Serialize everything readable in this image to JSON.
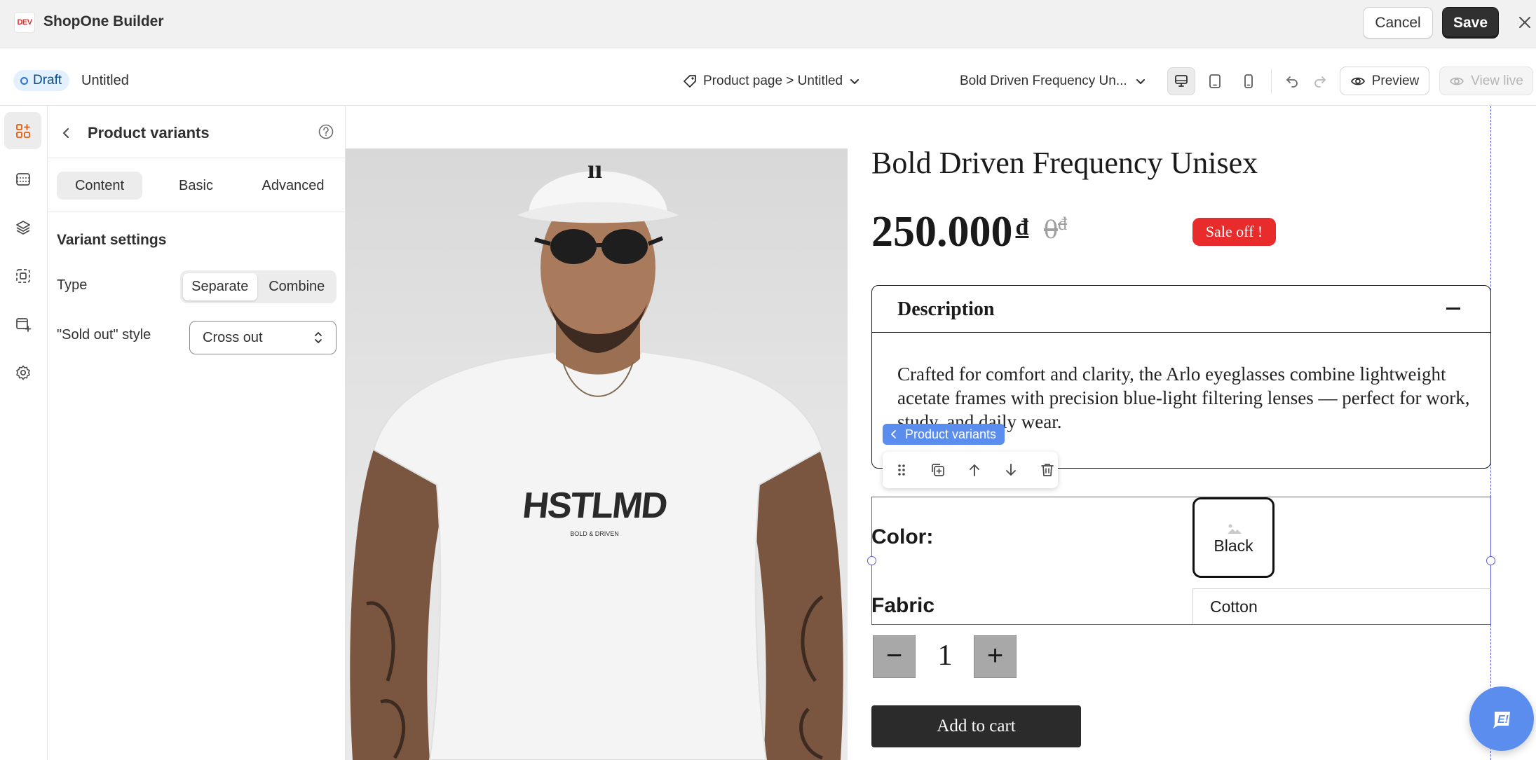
{
  "app": {
    "logo_text": "DEV",
    "title": "ShopOne Builder",
    "cancel_label": "Cancel",
    "save_label": "Save",
    "close_icon": "close-icon"
  },
  "toolbar": {
    "status_badge": "Draft",
    "page_name": "Untitled",
    "page_selector": "Product page > Untitled",
    "product_selector": "Bold Driven Frequency Un...",
    "devices": [
      "desktop",
      "tablet",
      "mobile"
    ],
    "active_device": "desktop",
    "preview_label": "Preview",
    "view_live_label": "View live"
  },
  "rail": {
    "items": [
      "add-elements-icon",
      "sections-icon",
      "layers-icon",
      "templates-icon",
      "add-page-icon",
      "settings-icon"
    ],
    "active": "add-elements-icon"
  },
  "panel": {
    "title": "Product variants",
    "tabs": [
      {
        "label": "Content",
        "active": true
      },
      {
        "label": "Basic",
        "active": false
      },
      {
        "label": "Advanced",
        "active": false
      }
    ],
    "section_title": "Variant settings",
    "type_label": "Type",
    "type_options": [
      {
        "label": "Separate",
        "active": true
      },
      {
        "label": "Combine",
        "active": false
      }
    ],
    "soldout_label": "\"Sold out\" style",
    "soldout_value": "Cross out"
  },
  "product": {
    "title": "Bold Driven Frequency Unisex",
    "price": "250.000",
    "currency": "đ",
    "compare_price": "0",
    "sale_badge": "Sale off !",
    "description_title": "Description",
    "description_text": "Crafted for comfort and clarity, the Arlo eyeglasses combine lightweight acetate frames with precision blue-light filtering lenses — perfect for work, study, and daily wear.",
    "variants": {
      "selection_label": "Product variants",
      "color_label": "Color:",
      "color_value": "Black",
      "fabric_label": "Fabric",
      "fabric_value": "Cotton"
    },
    "quantity": "1",
    "qty_minus": "−",
    "qty_plus": "+",
    "add_to_cart": "Add to cart",
    "tshirt_print": "HSTLMD",
    "tshirt_subprint": "BOLD & DRIVEN"
  },
  "colors": {
    "accent": "#5b8def",
    "selection": "#5b5bd6",
    "sale": "#e82c2c",
    "primary_button": "#303030"
  }
}
